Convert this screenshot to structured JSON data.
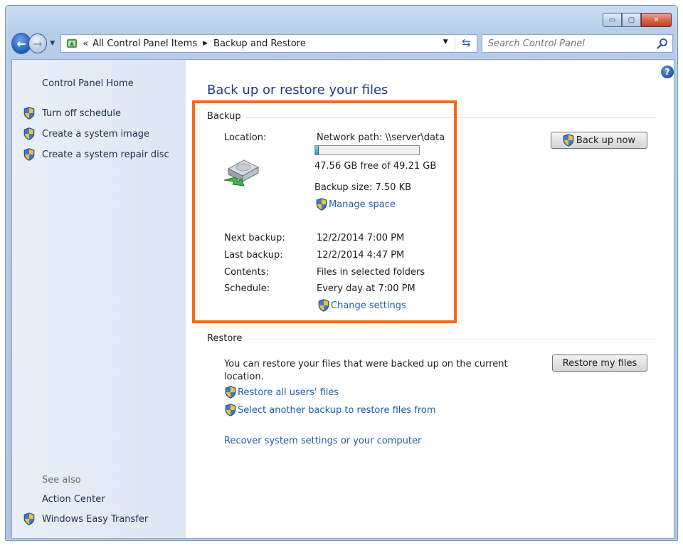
{
  "window": {
    "minimize_glyph": "▭",
    "maximize_glyph": "▢",
    "close_glyph": "✕"
  },
  "nav": {
    "back_glyph": "←",
    "forward_glyph": "→",
    "dropdown_glyph": "▼",
    "breadcrumb_chevron": "«",
    "breadcrumb": [
      "All Control Panel Items",
      "Backup and Restore"
    ],
    "breadcrumb_separator": "▶",
    "address_dropdown_glyph": "▼",
    "refresh_glyph": "⇆",
    "search_placeholder": "Search Control Panel"
  },
  "sidebar": {
    "home": "Control Panel Home",
    "links": [
      {
        "label": "Turn off schedule",
        "icon": "shield-icon"
      },
      {
        "label": "Create a system image",
        "icon": "shield-icon"
      },
      {
        "label": "Create a system repair disc",
        "icon": "shield-icon"
      }
    ],
    "see_also_label": "See also",
    "see_also": [
      {
        "label": "Action Center",
        "icon": null
      },
      {
        "label": "Windows Easy Transfer",
        "icon": "shield-icon"
      }
    ]
  },
  "main": {
    "help_glyph": "?",
    "title": "Back up or restore your files",
    "backup": {
      "heading": "Backup",
      "location_label": "Location:",
      "location_value": "Network path: \\\\server\\data",
      "free_space": "47.56 GB free of 49.21 GB",
      "used_fraction": 0.034,
      "backup_size": "Backup size: 7.50 KB",
      "manage_space": "Manage space",
      "back_up_now": "Back up now",
      "next_backup_label": "Next backup:",
      "next_backup_value": "12/2/2014 7:00 PM",
      "last_backup_label": "Last backup:",
      "last_backup_value": "12/2/2014 4:47 PM",
      "contents_label": "Contents:",
      "contents_value": "Files in selected folders",
      "schedule_label": "Schedule:",
      "schedule_value": "Every day at 7:00 PM",
      "change_settings": "Change settings"
    },
    "restore": {
      "heading": "Restore",
      "description_line1": "You can restore your files that were backed up on the current",
      "description_line2": "location.",
      "restore_my_files": "Restore my files",
      "restore_all_users": "Restore all users' files",
      "select_another": "Select another backup to restore files from",
      "recover_system": "Recover system settings or your computer"
    }
  },
  "colors": {
    "highlight": "#f26b1d",
    "link": "#1f5ea8",
    "title": "#1f3a8a",
    "sidebar_bg": "#dce7f4"
  }
}
